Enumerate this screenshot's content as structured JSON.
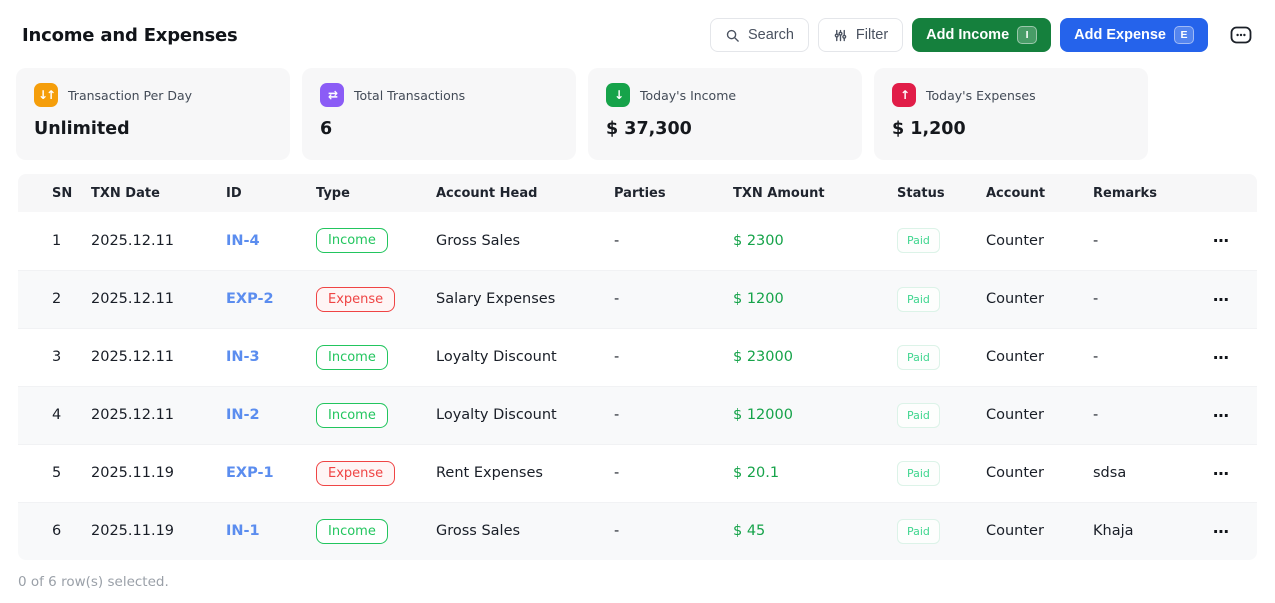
{
  "header": {
    "title": "Income and Expenses",
    "search_label": "Search",
    "filter_label": "Filter",
    "add_income_label": "Add Income",
    "add_income_shortcut": "I",
    "add_expense_label": "Add Expense",
    "add_expense_shortcut": "E"
  },
  "colors": {
    "add_income_green": "#15803d",
    "add_expense_blue": "#2563eb",
    "income_badge_green": "#22c55e",
    "expense_badge_red": "#ef4444",
    "amount_green": "#16a34a",
    "id_link_blue": "#5b8def",
    "stat_icon_orange": "#f59e0b",
    "stat_icon_purple": "#8b5cf6",
    "stat_icon_green": "#16a34a",
    "stat_icon_rose": "#e11d48"
  },
  "stats": [
    {
      "label": "Transaction Per Day",
      "value": "Unlimited",
      "icon": "swap-vertical-icon",
      "icon_glyph": "↓↑",
      "icon_color": "#f59e0b"
    },
    {
      "label": "Total Transactions",
      "value": "6",
      "icon": "swap-horizontal-icon",
      "icon_glyph": "⇄",
      "icon_color": "#8b5cf6"
    },
    {
      "label": "Today's Income",
      "value": "$ 37,300",
      "icon": "arrow-down-icon",
      "icon_glyph": "↓",
      "icon_color": "#16a34a"
    },
    {
      "label": "Today's Expenses",
      "value": "$ 1,200",
      "icon": "arrow-up-icon",
      "icon_glyph": "↑",
      "icon_color": "#e11d48"
    }
  ],
  "table": {
    "columns": [
      "SN",
      "TXN Date",
      "ID",
      "Type",
      "Account Head",
      "Parties",
      "TXN Amount",
      "Status",
      "Account",
      "Remarks"
    ],
    "rows": [
      {
        "sn": "1",
        "date": "2025.12.11",
        "id": "IN-4",
        "type": "Income",
        "account_head": "Gross Sales",
        "parties": "-",
        "amount": "$ 2300",
        "status": "Paid",
        "account": "Counter",
        "remarks": "-"
      },
      {
        "sn": "2",
        "date": "2025.12.11",
        "id": "EXP-2",
        "type": "Expense",
        "account_head": "Salary Expenses",
        "parties": "-",
        "amount": "$ 1200",
        "status": "Paid",
        "account": "Counter",
        "remarks": "-"
      },
      {
        "sn": "3",
        "date": "2025.12.11",
        "id": "IN-3",
        "type": "Income",
        "account_head": "Loyalty Discount",
        "parties": "-",
        "amount": "$ 23000",
        "status": "Paid",
        "account": "Counter",
        "remarks": "-"
      },
      {
        "sn": "4",
        "date": "2025.12.11",
        "id": "IN-2",
        "type": "Income",
        "account_head": "Loyalty Discount",
        "parties": "-",
        "amount": "$ 12000",
        "status": "Paid",
        "account": "Counter",
        "remarks": "-"
      },
      {
        "sn": "5",
        "date": "2025.11.19",
        "id": "EXP-1",
        "type": "Expense",
        "account_head": "Rent Expenses",
        "parties": "-",
        "amount": "$ 20.1",
        "status": "Paid",
        "account": "Counter",
        "remarks": "sdsa"
      },
      {
        "sn": "6",
        "date": "2025.11.19",
        "id": "IN-1",
        "type": "Income",
        "account_head": "Gross Sales",
        "parties": "-",
        "amount": "$ 45",
        "status": "Paid",
        "account": "Counter",
        "remarks": "Khaja"
      }
    ]
  },
  "footer": {
    "selection_text": "0 of 6 row(s) selected."
  }
}
